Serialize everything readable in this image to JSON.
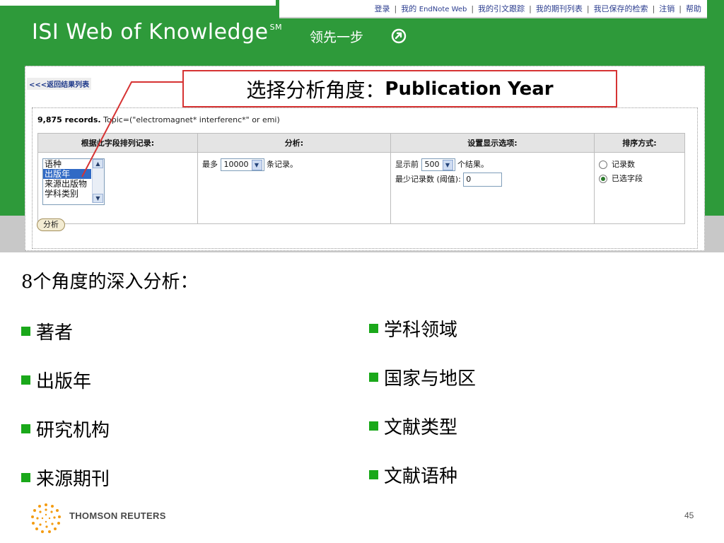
{
  "topnav": {
    "login": "登录",
    "my_endnote_prefix": "我的",
    "my_endnote_suffix": "EndNote Web",
    "citation_tracking": "我的引文跟踪",
    "journal_list": "我的期刊列表",
    "saved_searches": "我已保存的检索",
    "logout": "注销",
    "help": "帮助"
  },
  "brand": {
    "name": "ISI Web of Knowledge",
    "mark": "SM",
    "slogan": "领先一步"
  },
  "panel": {
    "back_link": "<<<返回结果列表",
    "records_count": "9,875 records.",
    "query": "Topic=(\"electromagnet* interferenc*\" or emi)",
    "headers": {
      "rank_by": "根据此字段排列记录:",
      "analyze": "分析:",
      "display": "设置显示选项:",
      "sort": "排序方式:"
    },
    "field_options": [
      "语种",
      "出版年",
      "来源出版物",
      "学科类别"
    ],
    "selected_field": "出版年",
    "analyze_prefix": "最多",
    "analyze_value": "10000",
    "analyze_suffix": "条记录。",
    "display_prefix": "显示前",
    "display_value": "500",
    "display_suffix": "个结果。",
    "min_records_label": "最少记录数 (阈值):",
    "min_records_value": "0",
    "sort_options": [
      "记录数",
      "已选字段"
    ],
    "sort_selected": "已选字段",
    "analyze_button": "分析"
  },
  "callout": {
    "prefix": "选择分析角度：",
    "value": "Publication Year",
    "color": "#d63333"
  },
  "content": {
    "heading": "8个角度的深入分析：",
    "left_items": [
      "著者",
      "出版年",
      "研究机构",
      "来源期刊"
    ],
    "right_items": [
      "学科领域",
      "国家与地区",
      "文献类型",
      "文献语种"
    ],
    "bullet_color": "#1aa81a"
  },
  "footer": {
    "company": "THOMSON REUTERS",
    "page_number": "45"
  },
  "colors": {
    "brand_green": "#2e9a3a",
    "link_blue": "#1f3a8a"
  }
}
